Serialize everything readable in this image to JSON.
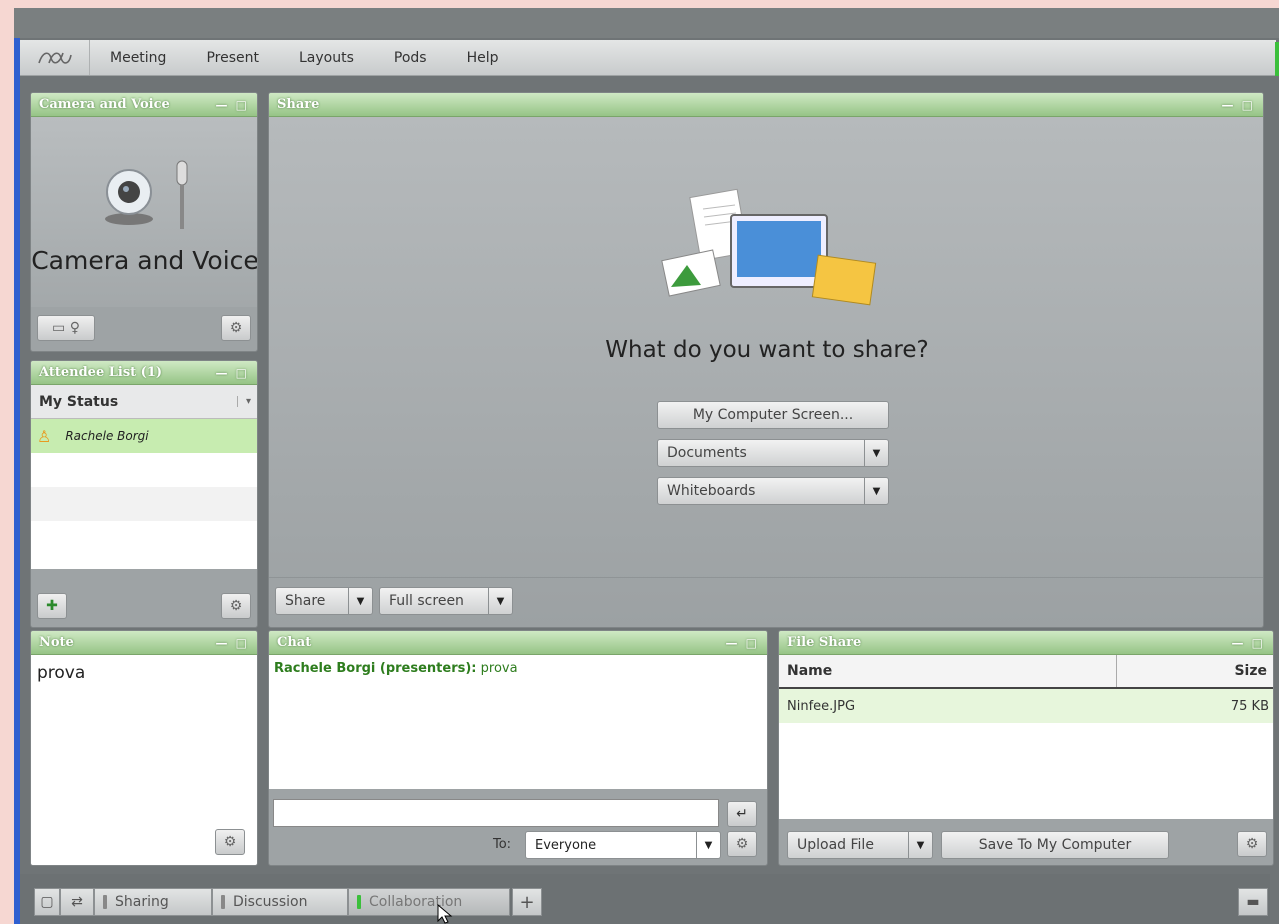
{
  "menu": {
    "items": [
      "Meeting",
      "Present",
      "Layouts",
      "Pods",
      "Help"
    ]
  },
  "camera": {
    "title": "Camera and Voice",
    "label": "Camera and Voice"
  },
  "attendees": {
    "title": "Attendee List (1)",
    "status_label": "My Status",
    "people": [
      "Rachele Borgi"
    ]
  },
  "share": {
    "title": "Share",
    "prompt": "What do you want to share?",
    "screen_btn": "My Computer Screen...",
    "documents": "Documents",
    "whiteboards": "Whiteboards",
    "share_btn": "Share",
    "fullscreen_btn": "Full screen"
  },
  "note": {
    "title": "Note",
    "text": "prova"
  },
  "chat": {
    "title": "Chat",
    "messages": [
      {
        "sender": "Rachele Borgi (presenters):",
        "text": "prova"
      }
    ],
    "to_label": "To:",
    "to_value": "Everyone"
  },
  "files": {
    "title": "File Share",
    "col_name": "Name",
    "col_size": "Size",
    "rows": [
      {
        "name": "Ninfee.JPG",
        "size": "75 KB"
      }
    ],
    "upload_btn": "Upload File",
    "save_btn": "Save To My Computer"
  },
  "tabs": {
    "items": [
      "Sharing",
      "Discussion",
      "Collaboration"
    ],
    "active": "Collaboration"
  },
  "colors": {
    "pod_header": "#96c486",
    "accent_green": "#3bbf3b",
    "chat_sender": "#2e7d1e"
  }
}
